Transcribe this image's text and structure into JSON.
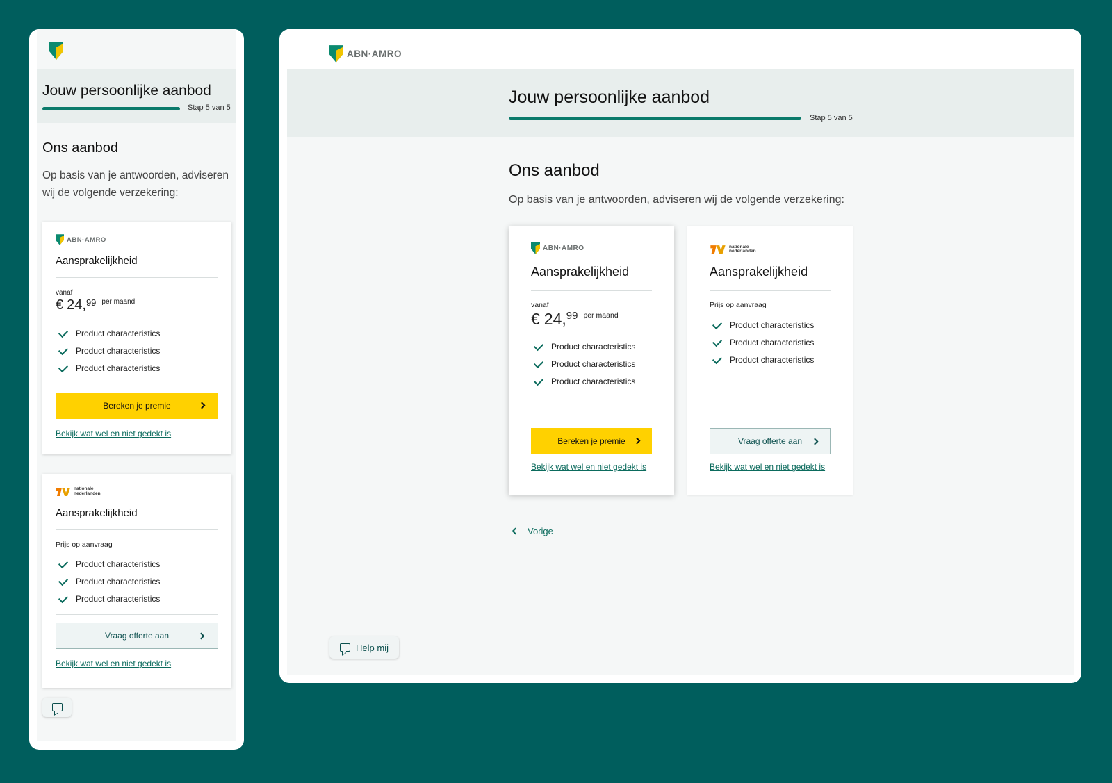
{
  "brand": {
    "name": "ABN·AMRO",
    "colors": {
      "primary": "#0b7a6b",
      "accent": "#ffd100",
      "background": "#005e5d"
    }
  },
  "header": {
    "title": "Jouw persoonlijke aanbod",
    "step": "Stap 5 van 5"
  },
  "main": {
    "heading": "Ons aanbod",
    "intro": "Op basis van je antwoorden, adviseren wij de volgende verzekering:"
  },
  "offers": [
    {
      "insurer": "ABN·AMRO",
      "title": "Aansprakelijkheid",
      "price_prefix": "vanaf",
      "currency": "€",
      "price_whole": "24,",
      "price_cents": "99",
      "price_period": "per maand",
      "features": [
        "Product characteristics",
        "Product characteristics",
        "Product characteristics"
      ],
      "cta": "Bereken je premie",
      "link": "Bekijk wat wel en niet gedekt is"
    },
    {
      "insurer": "nationale nederlanden",
      "insurer_line1": "nationale",
      "insurer_line2": "nederlanden",
      "title": "Aansprakelijkheid",
      "price_note": "Prijs op aanvraag",
      "features": [
        "Product characteristics",
        "Product characteristics",
        "Product characteristics"
      ],
      "cta": "Vraag offerte aan",
      "link": "Bekijk wat wel en niet gedekt is"
    }
  ],
  "nav": {
    "back": "Vorige"
  },
  "help": {
    "label": "Help mij"
  },
  "icons": [
    "abn-amro-shield-icon",
    "check-icon",
    "chevron-right-icon",
    "chevron-left-icon",
    "help-chat-icon",
    "nn-logo-icon"
  ]
}
